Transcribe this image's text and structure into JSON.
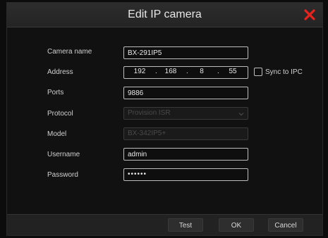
{
  "dialog": {
    "title": "Edit IP camera",
    "close_color": "#e8231d"
  },
  "form": {
    "camera_name": {
      "label": "Camera name",
      "value": "BX-291IP5"
    },
    "address": {
      "label": "Address",
      "octets": [
        "192",
        "168",
        "8",
        "55"
      ],
      "sync_label": "Sync to IPC",
      "sync_checked": false
    },
    "ports": {
      "label": "Ports",
      "value": "9886"
    },
    "protocol": {
      "label": "Protocol",
      "value": "Provision ISR"
    },
    "model": {
      "label": "Model",
      "value": "BX-342IP5+"
    },
    "username": {
      "label": "Username",
      "value": "admin"
    },
    "password": {
      "label": "Password",
      "value": "••••••"
    }
  },
  "buttons": {
    "test": "Test",
    "ok": "OK",
    "cancel": "Cancel"
  }
}
